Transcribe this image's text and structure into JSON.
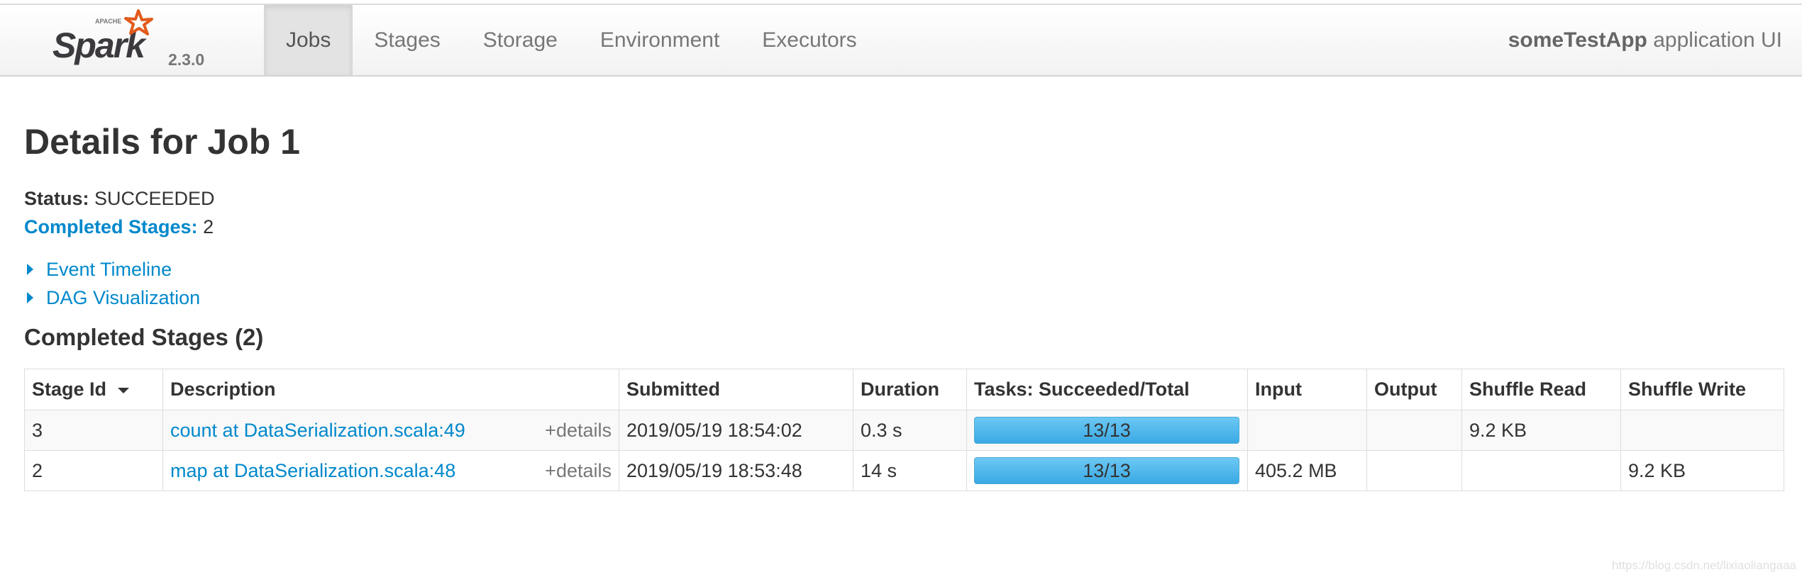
{
  "brand": {
    "logo_text": "Spark",
    "logo_small_text": "APACHE",
    "version": "2.3.0",
    "accent_color": "#e25a1c"
  },
  "nav": {
    "tabs": [
      {
        "label": "Jobs",
        "active": true
      },
      {
        "label": "Stages",
        "active": false
      },
      {
        "label": "Storage",
        "active": false
      },
      {
        "label": "Environment",
        "active": false
      },
      {
        "label": "Executors",
        "active": false
      }
    ],
    "app_name": "someTestApp",
    "app_suffix": " application UI"
  },
  "page": {
    "title": "Details for Job 1",
    "status_label": "Status:",
    "status_value": "SUCCEEDED",
    "completed_label": "Completed Stages:",
    "completed_value": "2",
    "expanders": [
      {
        "label": "Event Timeline",
        "icon": "triangle-right-icon"
      },
      {
        "label": "DAG Visualization",
        "icon": "triangle-right-icon"
      }
    ],
    "section_title": "Completed Stages (2)"
  },
  "table": {
    "headers": [
      "Stage Id",
      "Description",
      "Submitted",
      "Duration",
      "Tasks: Succeeded/Total",
      "Input",
      "Output",
      "Shuffle Read",
      "Shuffle Write"
    ],
    "rows": [
      {
        "stage_id": "3",
        "description": "count at DataSerialization.scala:49",
        "details": "+details",
        "submitted": "2019/05/19 18:54:02",
        "duration": "0.3 s",
        "tasks": "13/13",
        "tasks_fraction": 1.0,
        "input": "",
        "output": "",
        "shuffle_read": "9.2 KB",
        "shuffle_write": ""
      },
      {
        "stage_id": "2",
        "description": "map at DataSerialization.scala:48",
        "details": "+details",
        "submitted": "2019/05/19 18:53:48",
        "duration": "14 s",
        "tasks": "13/13",
        "tasks_fraction": 1.0,
        "input": "405.2 MB",
        "output": "",
        "shuffle_read": "",
        "shuffle_write": "9.2 KB"
      }
    ]
  },
  "watermark": "https://blog.csdn.net/lixiaoliangaaa",
  "colors": {
    "link": "#0088cc",
    "progress": "#3aa9e4"
  }
}
